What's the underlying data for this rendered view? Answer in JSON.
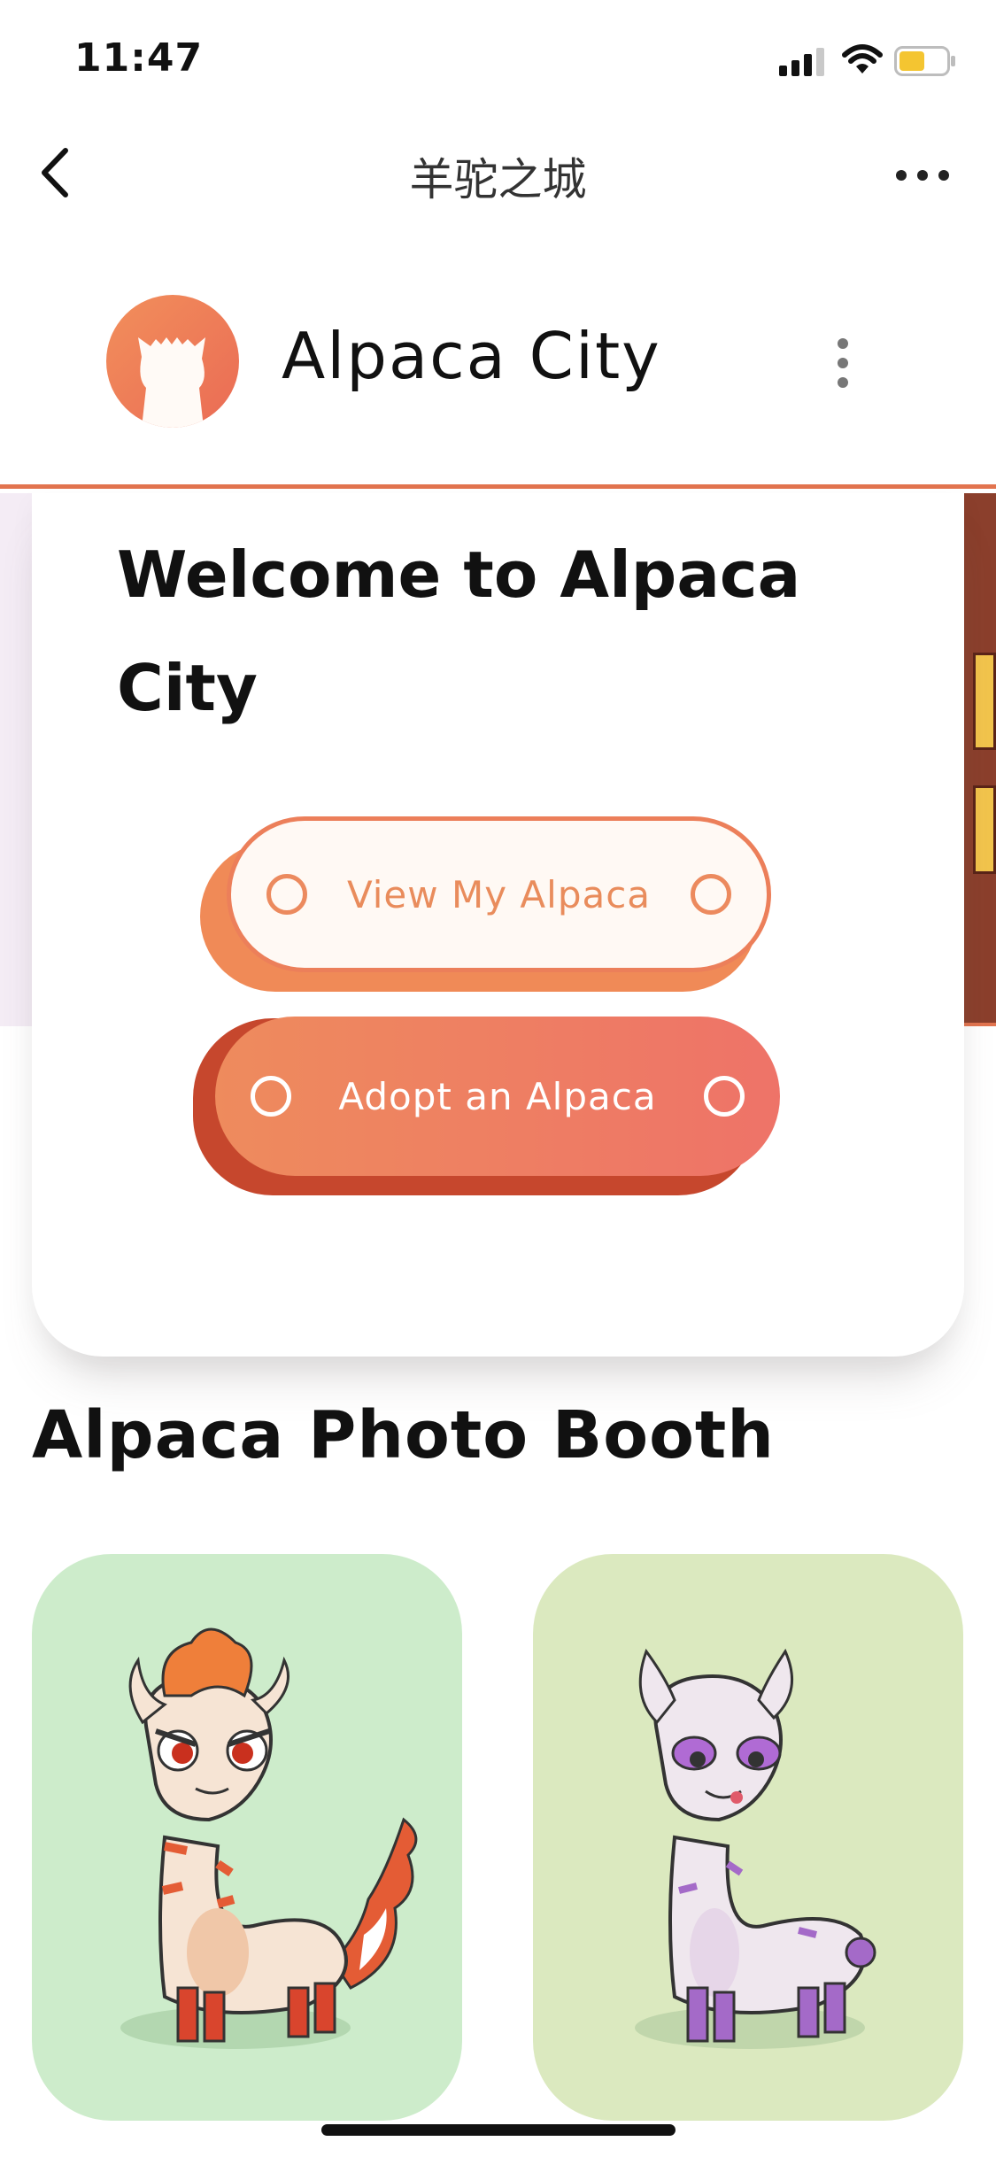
{
  "status_bar": {
    "time": "11:47",
    "icons": [
      "signal-icon",
      "wifi-icon",
      "battery-icon"
    ]
  },
  "nav": {
    "title": "羊驼之城",
    "back_icon": "chevron-left-icon",
    "more_icon": "more-horizontal-icon"
  },
  "header": {
    "title": "Alpaca City",
    "logo_icon": "alpaca-logo-icon",
    "menu_icon": "more-vertical-icon"
  },
  "welcome": {
    "title": "Welcome to Alpaca City",
    "view_button": "View My Alpaca",
    "adopt_button": "Adopt an Alpaca"
  },
  "booth": {
    "title": "Alpaca Photo Booth",
    "tiles": [
      {
        "icon": "alpaca-red-icon",
        "bg": "#cdeccb"
      },
      {
        "icon": "alpaca-purple-icon",
        "bg": "#dbe9bf"
      }
    ]
  },
  "colors": {
    "accent": "#ec7f5a",
    "accent_dark": "#c6472d",
    "text": "#111111"
  }
}
